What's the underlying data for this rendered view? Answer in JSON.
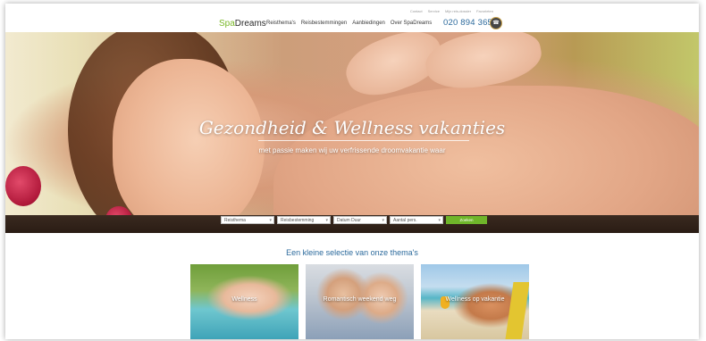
{
  "header": {
    "logo_spa": "Spa",
    "logo_dreams": "Dreams",
    "nav": [
      "Reisthema's",
      "Reisbestemmingen",
      "Aanbiedingen",
      "Over SpaDreams"
    ],
    "phone": "020 894 3655",
    "util_links": [
      "Contact",
      "Service",
      "Mijn reis-dossier",
      "Favorieten"
    ]
  },
  "hero": {
    "title": "Gezondheid & Wellness vakanties",
    "subtitle": "met passie maken wij uw verfrissende droomvakantie waar"
  },
  "search": {
    "fields": [
      "Reisthema",
      "Reisbestemming",
      "Datum Duur",
      "Aantal pers."
    ],
    "button": "Zoeken"
  },
  "section": {
    "title": "Een kleine selectie van onze thema's",
    "cards": [
      "Wellness",
      "Romantisch weekend weg",
      "Wellness op vakantie"
    ]
  },
  "colors": {
    "accent_green": "#6fb52a",
    "link_blue": "#2d6b9d"
  }
}
